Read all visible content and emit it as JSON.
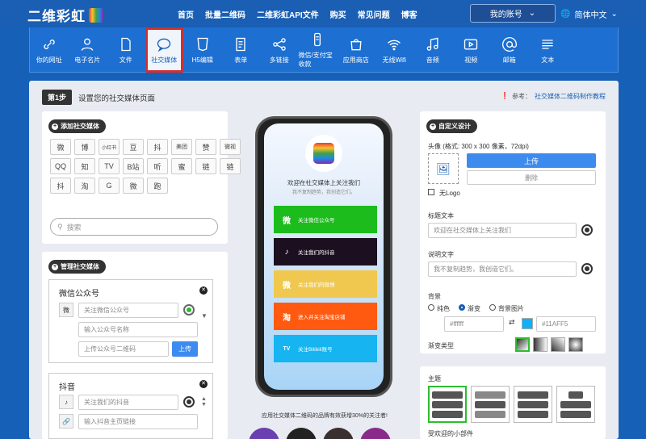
{
  "header": {
    "logo": "二维彩虹",
    "nav": [
      "首页",
      "批量二维码",
      "二维彩虹API文件",
      "购买",
      "常见问题",
      "博客"
    ],
    "account": "我的账号",
    "language": "简体中文"
  },
  "toolbar": [
    {
      "label": "你的网址",
      "icon": "link-icon"
    },
    {
      "label": "电子名片",
      "icon": "person-icon"
    },
    {
      "label": "文件",
      "icon": "file-icon"
    },
    {
      "label": "社交媒体",
      "icon": "chat-bubble-icon",
      "active": true
    },
    {
      "label": "H5编辑",
      "icon": "html-icon"
    },
    {
      "label": "表单",
      "icon": "form-icon"
    },
    {
      "label": "多链接",
      "icon": "share-icon"
    },
    {
      "label": "微信/支付宝收款",
      "icon": "payment-icon"
    },
    {
      "label": "应用商店",
      "icon": "store-icon"
    },
    {
      "label": "无线Wifi",
      "icon": "wifi-icon"
    },
    {
      "label": "音频",
      "icon": "music-icon"
    },
    {
      "label": "视频",
      "icon": "video-icon"
    },
    {
      "label": "邮箱",
      "icon": "at-icon"
    },
    {
      "label": "文本",
      "icon": "text-icon"
    }
  ],
  "step": {
    "badge": "第1步",
    "text": "设置您的社交媒体页面",
    "ref_label": "参考：",
    "ref_link": "社交媒体二维码制作教程"
  },
  "add_panel": {
    "title": "添加社交媒体",
    "icons": [
      "微",
      "博",
      "小红书",
      "豆",
      "抖",
      "美团",
      "赞",
      "微视",
      "QQ",
      "知",
      "TV",
      "B站",
      "听",
      "蜜",
      "链",
      "链",
      "抖",
      "淘",
      "G",
      "微",
      "跑"
    ],
    "search_placeholder": "搜索"
  },
  "manage_panel": {
    "title": "管理社交媒体",
    "wechat": {
      "name": "微信公众号",
      "label_value": "关注微信公众号",
      "name_placeholder": "输入公众号名称",
      "upload_placeholder": "上传公众号二维码",
      "upload_btn": "上传"
    },
    "douyin": {
      "name": "抖音",
      "label_value": "关注我们的抖音",
      "link_placeholder": "输入抖音主页链接"
    }
  },
  "preview": {
    "title": "欢迎在社交媒体上关注我们",
    "subtitle": "我不复制趋势，我创造它们。",
    "buttons": [
      {
        "label": "关注微信公众号",
        "color": "#1dbc1d",
        "icon": "微"
      },
      {
        "label": "关注我们的抖音",
        "color": "#1c1020",
        "icon": "♪"
      },
      {
        "label": "关注我们的微博",
        "color": "#f0c850",
        "icon": "微"
      },
      {
        "label": "进入并关注淘宝店铺",
        "color": "#ff5a10",
        "icon": "淘"
      },
      {
        "label": "关注Bilibili账号",
        "color": "#16b4f0",
        "icon": "TV"
      }
    ],
    "caption": "应用社交媒体二维码的品牌有效获增30%的关注者!"
  },
  "custom": {
    "title": "自定义设计",
    "avatar_label": "头像 (格式: 300 x 300 像素，72dpi)",
    "upload": "上传",
    "delete": "删除",
    "no_logo": "无Logo",
    "title_label": "标题文本",
    "title_value": "欢迎在社交媒体上关注我们",
    "desc_label": "说明文字",
    "desc_value": "我不复制趋势，我创造它们。",
    "bg_label": "背景",
    "bg_options": [
      "纯色",
      "渐变",
      "背景图片"
    ],
    "color1": "#ffffff",
    "color2": "#11AFF5",
    "gradient_label": "渐变类型",
    "theme_label": "主题",
    "widget_label": "受欢迎的小部件"
  }
}
